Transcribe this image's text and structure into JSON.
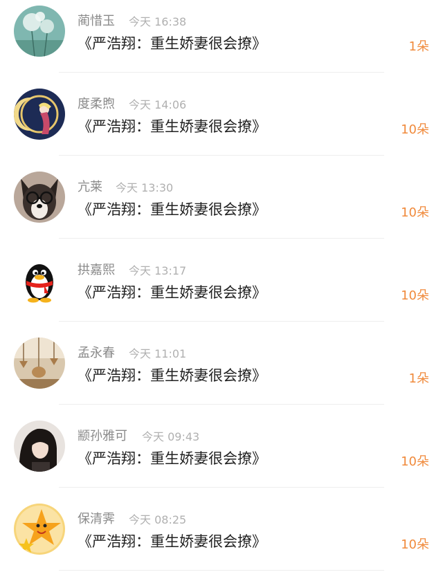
{
  "accent_color": "#f08a3c",
  "items": [
    {
      "name": "蔺惜玉",
      "time": "今天 16:38",
      "title": "《严浩翔：重生娇妻很会撩》",
      "count": "1朵",
      "avatar_icon": "dandelion-photo-avatar"
    },
    {
      "name": "度柔煦",
      "time": "今天 14:06",
      "title": "《严浩翔：重生娇妻很会撩》",
      "count": "10朵",
      "avatar_icon": "anime-moon-avatar"
    },
    {
      "name": "亢莱",
      "time": "今天 13:30",
      "title": "《严浩翔：重生娇妻很会撩》",
      "count": "10朵",
      "avatar_icon": "dog-with-glasses-avatar"
    },
    {
      "name": "拱嘉熙",
      "time": "今天 13:17",
      "title": "《严浩翔：重生娇妻很会撩》",
      "count": "10朵",
      "avatar_icon": "qq-penguin-avatar"
    },
    {
      "name": "孟永春",
      "time": "今天 11:01",
      "title": "《严浩翔：重生娇妻很会撩》",
      "count": "1朵",
      "avatar_icon": "wind-chime-avatar"
    },
    {
      "name": "颛孙雅可",
      "time": "今天 09:43",
      "title": "《严浩翔：重生娇妻很会撩》",
      "count": "10朵",
      "avatar_icon": "girl-portrait-avatar"
    },
    {
      "name": "保清霁",
      "time": "今天 08:25",
      "title": "《严浩翔：重生娇妻很会撩》",
      "count": "10朵",
      "avatar_icon": "star-cartoon-avatar"
    }
  ]
}
